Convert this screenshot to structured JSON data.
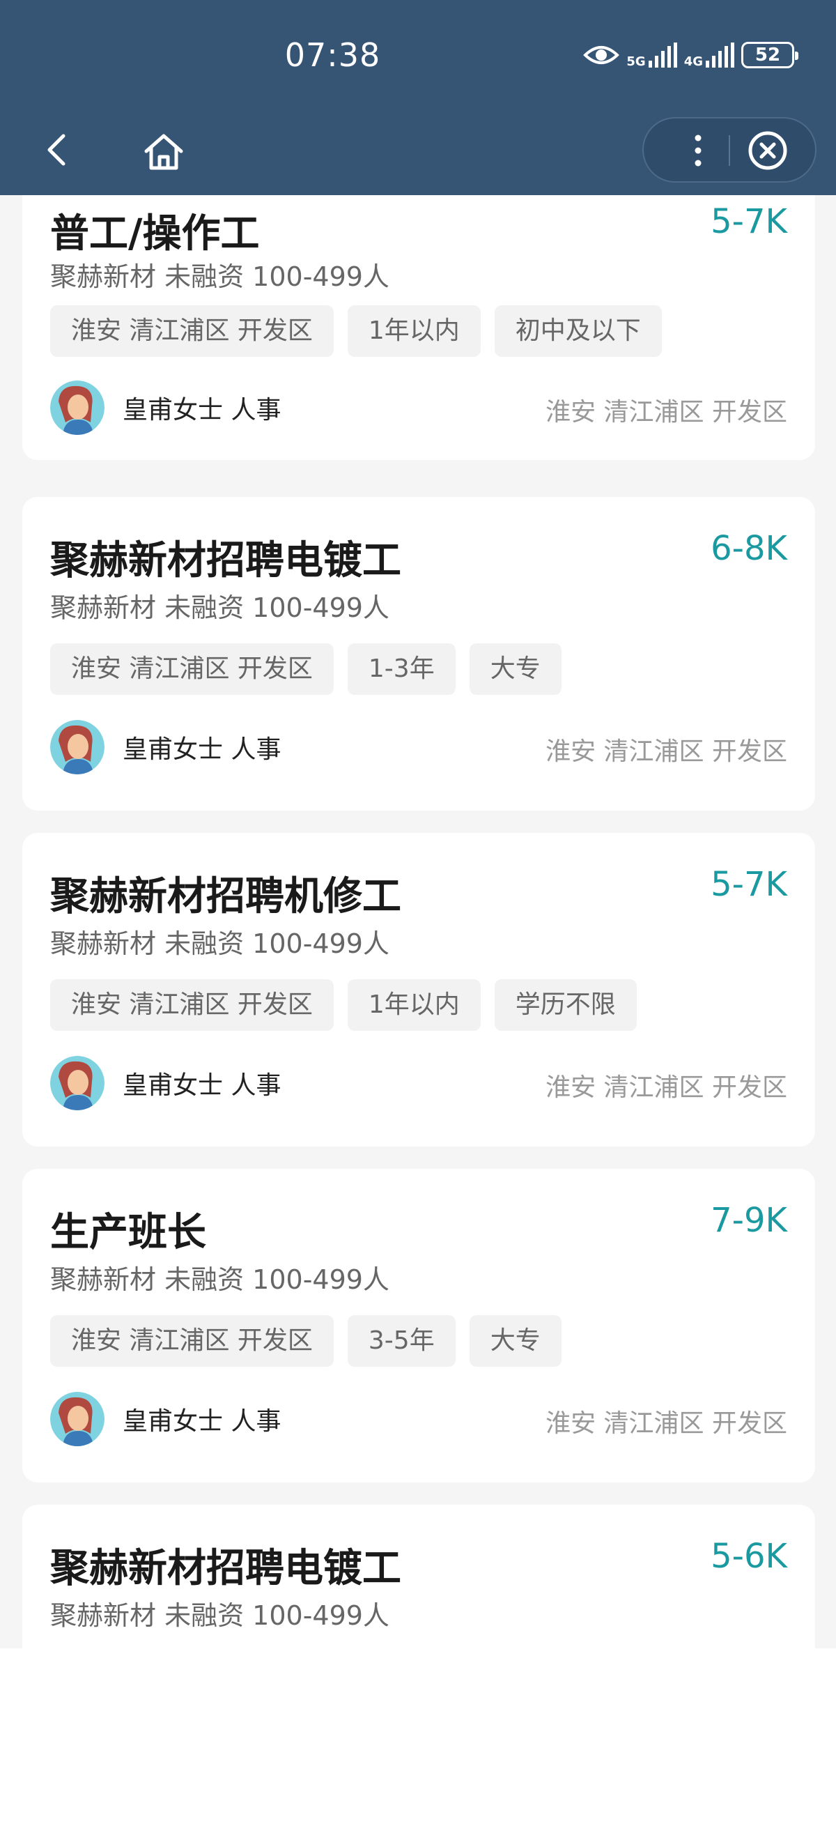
{
  "status": {
    "time": "07:38",
    "net1": "5G",
    "net2": "4G",
    "battery": "52"
  },
  "jobs": [
    {
      "title": "普工/操作工",
      "salary": "5-7K",
      "company": "聚赫新材 未融资 100-499人",
      "tags": [
        "淮安 清江浦区 开发区",
        "1年以内",
        "初中及以下"
      ],
      "recruiter": "皇甫女士 人事",
      "location": "淮安 清江浦区 开发区"
    },
    {
      "title": "聚赫新材招聘电镀工",
      "salary": "6-8K",
      "company": "聚赫新材 未融资 100-499人",
      "tags": [
        "淮安 清江浦区 开发区",
        "1-3年",
        "大专"
      ],
      "recruiter": "皇甫女士 人事",
      "location": "淮安 清江浦区 开发区"
    },
    {
      "title": "聚赫新材招聘机修工",
      "salary": "5-7K",
      "company": "聚赫新材 未融资 100-499人",
      "tags": [
        "淮安 清江浦区 开发区",
        "1年以内",
        "学历不限"
      ],
      "recruiter": "皇甫女士 人事",
      "location": "淮安 清江浦区 开发区"
    },
    {
      "title": "生产班长",
      "salary": "7-9K",
      "company": "聚赫新材 未融资 100-499人",
      "tags": [
        "淮安 清江浦区 开发区",
        "3-5年",
        "大专"
      ],
      "recruiter": "皇甫女士 人事",
      "location": "淮安 清江浦区 开发区"
    },
    {
      "title": "聚赫新材招聘电镀工",
      "salary": "5-6K",
      "company": "聚赫新材 未融资 100-499人"
    }
  ],
  "icons": {
    "back": "chevron-left-icon",
    "home": "home-icon",
    "more": "more-vertical-icon",
    "close": "close-circle-icon",
    "eye": "eye-icon"
  },
  "colors": {
    "header": "#365575",
    "salary": "#1a9aa0"
  }
}
